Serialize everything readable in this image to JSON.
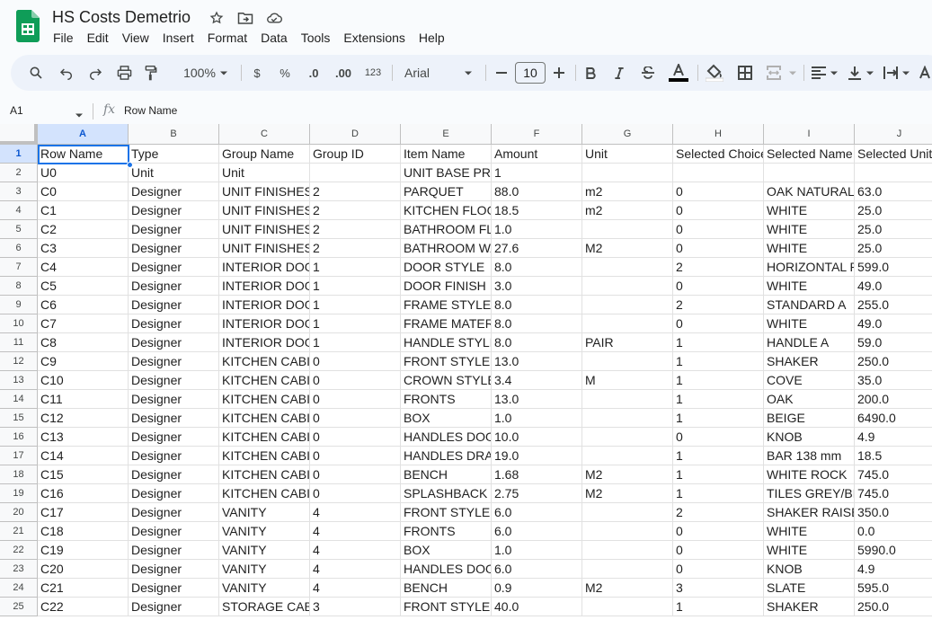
{
  "app": {
    "title": "HS Costs Demetrio",
    "brand_color": "#0f9d58",
    "menu": [
      "File",
      "Edit",
      "View",
      "Insert",
      "Format",
      "Data",
      "Tools",
      "Extensions",
      "Help"
    ]
  },
  "toolbar": {
    "zoom": "100%",
    "currency": "$",
    "percent": "%",
    "dec_decrease": ".0",
    "dec_increase": ".00",
    "number_format": "123",
    "font": "Arial",
    "font_size": "10",
    "icons": [
      "search-icon",
      "undo-icon",
      "redo-icon",
      "print-icon",
      "paint-format-icon",
      "bold-icon",
      "italic-icon",
      "strikethrough-icon",
      "text-color-icon",
      "fill-color-icon",
      "borders-icon",
      "merge-cells-icon",
      "align-icon",
      "valign-icon",
      "text-wrap-icon"
    ]
  },
  "formula_bar": {
    "cell_ref": "A1",
    "content": "Row Name"
  },
  "grid": {
    "columns": [
      "A",
      "B",
      "C",
      "D",
      "E",
      "F",
      "G",
      "H",
      "I",
      "J"
    ],
    "rows": [
      [
        "Row Name",
        "Type",
        "Group Name",
        "Group ID",
        "Item Name",
        "Amount",
        "Unit",
        "Selected Choice",
        "Selected Name",
        "Selected Unit"
      ],
      [
        "U0",
        "Unit",
        "Unit",
        "",
        "UNIT BASE PRI",
        "1",
        "",
        "",
        "",
        ""
      ],
      [
        "C0",
        "Designer",
        "UNIT FINISHES",
        "2",
        "PARQUET",
        "88.0",
        "m2",
        "0",
        "OAK NATURAL",
        "63.0"
      ],
      [
        "C1",
        "Designer",
        "UNIT FINISHES",
        "2",
        "KITCHEN FLOO",
        "18.5",
        "m2",
        "0",
        "WHITE",
        "25.0"
      ],
      [
        "C2",
        "Designer",
        "UNIT FINISHES",
        "2",
        "BATHROOM FL",
        "1.0",
        "",
        "0",
        "WHITE",
        "25.0"
      ],
      [
        "C3",
        "Designer",
        "UNIT FINISHES",
        "2",
        "BATHROOM WA",
        "27.6",
        "M2",
        "0",
        "WHITE",
        "25.0"
      ],
      [
        "C4",
        "Designer",
        "INTERIOR DOO",
        "1",
        "DOOR STYLE",
        "8.0",
        "",
        "2",
        "HORIZONTAL R",
        "599.0"
      ],
      [
        "C5",
        "Designer",
        "INTERIOR DOO",
        "1",
        "DOOR FINISH",
        "3.0",
        "",
        "0",
        "WHITE",
        "49.0"
      ],
      [
        "C6",
        "Designer",
        "INTERIOR DOO",
        "1",
        "FRAME STYLE",
        "8.0",
        "",
        "2",
        "STANDARD A",
        "255.0"
      ],
      [
        "C7",
        "Designer",
        "INTERIOR DOO",
        "1",
        "FRAME MATER",
        "8.0",
        "",
        "0",
        "WHITE",
        "49.0"
      ],
      [
        "C8",
        "Designer",
        "INTERIOR DOO",
        "1",
        "HANDLE STYLE",
        "8.0",
        "PAIR",
        "1",
        "HANDLE A",
        "59.0"
      ],
      [
        "C9",
        "Designer",
        "KITCHEN CABII",
        "0",
        "FRONT STYLE",
        "13.0",
        "",
        "1",
        "SHAKER",
        "250.0"
      ],
      [
        "C10",
        "Designer",
        "KITCHEN CABII",
        "0",
        "CROWN STYLE",
        "3.4",
        "M",
        "1",
        "COVE",
        "35.0"
      ],
      [
        "C11",
        "Designer",
        "KITCHEN CABII",
        "0",
        "FRONTS",
        "13.0",
        "",
        "1",
        "OAK",
        "200.0"
      ],
      [
        "C12",
        "Designer",
        "KITCHEN CABII",
        "0",
        "BOX",
        "1.0",
        "",
        "1",
        "BEIGE",
        "6490.0"
      ],
      [
        "C13",
        "Designer",
        "KITCHEN CABII",
        "0",
        "HANDLES DOO",
        "10.0",
        "",
        "0",
        "KNOB",
        "4.9"
      ],
      [
        "C14",
        "Designer",
        "KITCHEN CABII",
        "0",
        "HANDLES DRAV",
        "19.0",
        "",
        "1",
        "BAR 138 mm",
        "18.5"
      ],
      [
        "C15",
        "Designer",
        "KITCHEN CABII",
        "0",
        "BENCH",
        "1.68",
        "M2",
        "1",
        "WHITE ROCK",
        "745.0"
      ],
      [
        "C16",
        "Designer",
        "KITCHEN CABII",
        "0",
        "SPLASHBACK",
        "2.75",
        "M2",
        "1",
        "TILES GREY/BL",
        "745.0"
      ],
      [
        "C17",
        "Designer",
        "VANITY",
        "4",
        "FRONT STYLE",
        "6.0",
        "",
        "2",
        "SHAKER RAISE",
        "350.0"
      ],
      [
        "C18",
        "Designer",
        "VANITY",
        "4",
        "FRONTS",
        "6.0",
        "",
        "0",
        "WHITE",
        "0.0"
      ],
      [
        "C19",
        "Designer",
        "VANITY",
        "4",
        "BOX",
        "1.0",
        "",
        "0",
        "WHITE",
        "5990.0"
      ],
      [
        "C20",
        "Designer",
        "VANITY",
        "4",
        "HANDLES DOO",
        "6.0",
        "",
        "0",
        "KNOB",
        "4.9"
      ],
      [
        "C21",
        "Designer",
        "VANITY",
        "4",
        "BENCH",
        "0.9",
        "M2",
        "3",
        "SLATE",
        "595.0"
      ],
      [
        "C22",
        "Designer",
        "STORAGE CAB",
        "3",
        "FRONT STYLE",
        "40.0",
        "",
        "1",
        "SHAKER",
        "250.0"
      ]
    ]
  }
}
